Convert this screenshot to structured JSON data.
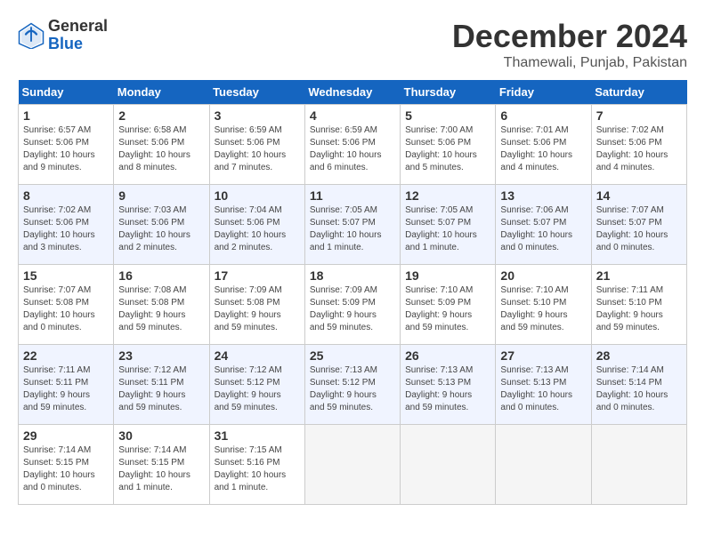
{
  "header": {
    "logo_general": "General",
    "logo_blue": "Blue",
    "month": "December 2024",
    "location": "Thamewali, Punjab, Pakistan"
  },
  "days_of_week": [
    "Sunday",
    "Monday",
    "Tuesday",
    "Wednesday",
    "Thursday",
    "Friday",
    "Saturday"
  ],
  "weeks": [
    [
      {
        "day": 1,
        "info": "Sunrise: 6:57 AM\nSunset: 5:06 PM\nDaylight: 10 hours\nand 9 minutes."
      },
      {
        "day": 2,
        "info": "Sunrise: 6:58 AM\nSunset: 5:06 PM\nDaylight: 10 hours\nand 8 minutes."
      },
      {
        "day": 3,
        "info": "Sunrise: 6:59 AM\nSunset: 5:06 PM\nDaylight: 10 hours\nand 7 minutes."
      },
      {
        "day": 4,
        "info": "Sunrise: 6:59 AM\nSunset: 5:06 PM\nDaylight: 10 hours\nand 6 minutes."
      },
      {
        "day": 5,
        "info": "Sunrise: 7:00 AM\nSunset: 5:06 PM\nDaylight: 10 hours\nand 5 minutes."
      },
      {
        "day": 6,
        "info": "Sunrise: 7:01 AM\nSunset: 5:06 PM\nDaylight: 10 hours\nand 4 minutes."
      },
      {
        "day": 7,
        "info": "Sunrise: 7:02 AM\nSunset: 5:06 PM\nDaylight: 10 hours\nand 4 minutes."
      }
    ],
    [
      {
        "day": 8,
        "info": "Sunrise: 7:02 AM\nSunset: 5:06 PM\nDaylight: 10 hours\nand 3 minutes."
      },
      {
        "day": 9,
        "info": "Sunrise: 7:03 AM\nSunset: 5:06 PM\nDaylight: 10 hours\nand 2 minutes."
      },
      {
        "day": 10,
        "info": "Sunrise: 7:04 AM\nSunset: 5:06 PM\nDaylight: 10 hours\nand 2 minutes."
      },
      {
        "day": 11,
        "info": "Sunrise: 7:05 AM\nSunset: 5:07 PM\nDaylight: 10 hours\nand 1 minute."
      },
      {
        "day": 12,
        "info": "Sunrise: 7:05 AM\nSunset: 5:07 PM\nDaylight: 10 hours\nand 1 minute."
      },
      {
        "day": 13,
        "info": "Sunrise: 7:06 AM\nSunset: 5:07 PM\nDaylight: 10 hours\nand 0 minutes."
      },
      {
        "day": 14,
        "info": "Sunrise: 7:07 AM\nSunset: 5:07 PM\nDaylight: 10 hours\nand 0 minutes."
      }
    ],
    [
      {
        "day": 15,
        "info": "Sunrise: 7:07 AM\nSunset: 5:08 PM\nDaylight: 10 hours\nand 0 minutes."
      },
      {
        "day": 16,
        "info": "Sunrise: 7:08 AM\nSunset: 5:08 PM\nDaylight: 9 hours\nand 59 minutes."
      },
      {
        "day": 17,
        "info": "Sunrise: 7:09 AM\nSunset: 5:08 PM\nDaylight: 9 hours\nand 59 minutes."
      },
      {
        "day": 18,
        "info": "Sunrise: 7:09 AM\nSunset: 5:09 PM\nDaylight: 9 hours\nand 59 minutes."
      },
      {
        "day": 19,
        "info": "Sunrise: 7:10 AM\nSunset: 5:09 PM\nDaylight: 9 hours\nand 59 minutes."
      },
      {
        "day": 20,
        "info": "Sunrise: 7:10 AM\nSunset: 5:10 PM\nDaylight: 9 hours\nand 59 minutes."
      },
      {
        "day": 21,
        "info": "Sunrise: 7:11 AM\nSunset: 5:10 PM\nDaylight: 9 hours\nand 59 minutes."
      }
    ],
    [
      {
        "day": 22,
        "info": "Sunrise: 7:11 AM\nSunset: 5:11 PM\nDaylight: 9 hours\nand 59 minutes."
      },
      {
        "day": 23,
        "info": "Sunrise: 7:12 AM\nSunset: 5:11 PM\nDaylight: 9 hours\nand 59 minutes."
      },
      {
        "day": 24,
        "info": "Sunrise: 7:12 AM\nSunset: 5:12 PM\nDaylight: 9 hours\nand 59 minutes."
      },
      {
        "day": 25,
        "info": "Sunrise: 7:13 AM\nSunset: 5:12 PM\nDaylight: 9 hours\nand 59 minutes."
      },
      {
        "day": 26,
        "info": "Sunrise: 7:13 AM\nSunset: 5:13 PM\nDaylight: 9 hours\nand 59 minutes."
      },
      {
        "day": 27,
        "info": "Sunrise: 7:13 AM\nSunset: 5:13 PM\nDaylight: 10 hours\nand 0 minutes."
      },
      {
        "day": 28,
        "info": "Sunrise: 7:14 AM\nSunset: 5:14 PM\nDaylight: 10 hours\nand 0 minutes."
      }
    ],
    [
      {
        "day": 29,
        "info": "Sunrise: 7:14 AM\nSunset: 5:15 PM\nDaylight: 10 hours\nand 0 minutes."
      },
      {
        "day": 30,
        "info": "Sunrise: 7:14 AM\nSunset: 5:15 PM\nDaylight: 10 hours\nand 1 minute."
      },
      {
        "day": 31,
        "info": "Sunrise: 7:15 AM\nSunset: 5:16 PM\nDaylight: 10 hours\nand 1 minute."
      },
      null,
      null,
      null,
      null
    ]
  ]
}
